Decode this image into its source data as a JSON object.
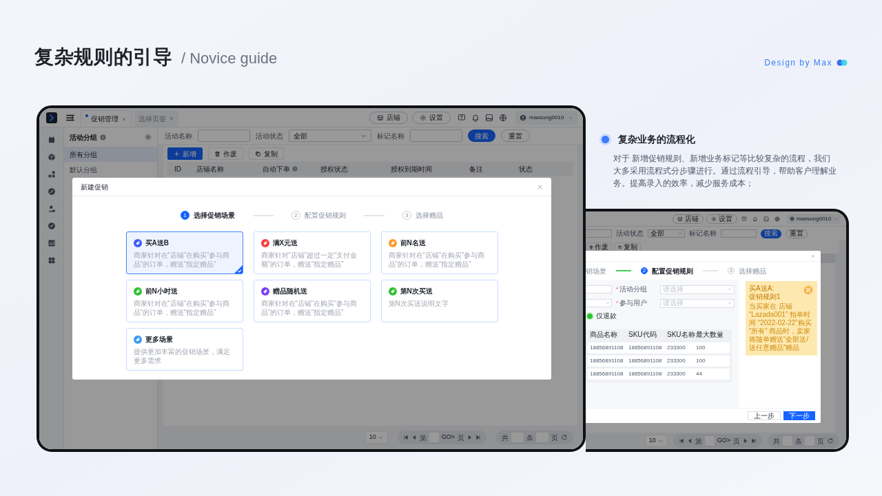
{
  "header": {
    "title": "复杂规则的引导",
    "subtitle": "/ Novice guide",
    "credit": "Design by Max"
  },
  "feature": {
    "title": "复杂业务的流程化",
    "text": "对于  新增促销规则、新增业务标记等比较复杂的流程，我们大多采用流程式分步骤进行。通过流程引导，帮助客户理解业务。提高录入的效率，减少服务成本；"
  },
  "main_screen": {
    "tabs": [
      {
        "label": "促销管理",
        "selected": true
      },
      {
        "label": "选择页签",
        "selected": false
      }
    ],
    "top_buttons": [
      "店铺",
      "设置"
    ],
    "user": "maxsong0010",
    "group_panel": {
      "title": "活动分组",
      "items": [
        {
          "label": "所有分组",
          "selected": true
        },
        {
          "label": "默认分组",
          "selected": false
        }
      ]
    },
    "filters": [
      {
        "label": "活动名称",
        "kind": "input"
      },
      {
        "label": "活动状态",
        "kind": "select",
        "value": "全部"
      },
      {
        "label": "标记名称",
        "kind": "input"
      }
    ],
    "filter_buttons": [
      {
        "label": "搜索",
        "primary": true
      },
      {
        "label": "重置",
        "primary": false
      }
    ],
    "toolbar": [
      {
        "label": "新增",
        "kind": "add"
      },
      {
        "label": "作废",
        "kind": "void"
      },
      {
        "label": "复制",
        "kind": "copy"
      }
    ],
    "table_columns": [
      "ID",
      "店铺名称",
      "自动下单",
      "授权状态",
      "授权到期时间",
      "备注",
      "状态"
    ],
    "modal": {
      "title": "新建促销",
      "steps": [
        {
          "number": "1",
          "label": "选择促销场景",
          "current": true,
          "done": false
        },
        {
          "number": "2",
          "label": "配置促销规则",
          "current": false,
          "done": false
        },
        {
          "number": "3",
          "label": "选择赠品",
          "current": false,
          "done": false
        }
      ],
      "cards": [
        {
          "title": "买A送B",
          "text": "商家针对在“店铺”在购买“参与商品”的订单，赠送“指定赠品”",
          "color": "#3d5afe",
          "selected": true
        },
        {
          "title": "满X元送",
          "text": "商家针对“店铺”超过一定“支付金额”的订单，赠送“指定赠品”",
          "color": "#f53f3f",
          "selected": false
        },
        {
          "title": "前N名送",
          "text": "商家针对在“店铺”在购买“参与商品”的订单，赠送“指定赠品”",
          "color": "#ff9a2e",
          "selected": false
        },
        {
          "title": "前N小时送",
          "text": "商家针对在“店铺”在购买“参与商品”的订单，赠送“指定赠品”",
          "color": "#2fc22f",
          "selected": false
        },
        {
          "title": "赠品随机送",
          "text": "商家针对在“店铺”在购买“参与商品”的订单，赠送“指定赠品”",
          "color": "#7b3ff2",
          "selected": false
        },
        {
          "title": "第N次买送",
          "text": "第N次买送说明文字",
          "color": "#2fc22f",
          "selected": false
        },
        {
          "title": "更多场景",
          "text": "提供更加丰富的促销场景，满足更多需求",
          "color": "#3b9cf6",
          "selected": false
        }
      ]
    },
    "pagination": {
      "page_size": "10",
      "first": "第",
      "go": "GO>",
      "page": "页",
      "total": "共",
      "items": "条",
      "pages": "页"
    }
  },
  "side_screen": {
    "top_buttons": [
      "店铺",
      "设置"
    ],
    "user": "maxsong0010",
    "filters": [
      {
        "label": "活动状态",
        "kind": "select",
        "value": "全部"
      },
      {
        "label": "标记名称",
        "kind": "input"
      }
    ],
    "filter_buttons": [
      {
        "label": "搜索",
        "primary": true
      },
      {
        "label": "重置",
        "primary": false
      }
    ],
    "toolbar": [
      {
        "label": "作废",
        "kind": "void"
      },
      {
        "label": "复制",
        "kind": "copy"
      }
    ],
    "steps": [
      {
        "label": "销场景",
        "current": false,
        "done": true
      },
      {
        "number": "2",
        "label": "配置促销规则",
        "current": true,
        "done": false
      },
      {
        "number": "3",
        "label": "选择赠品",
        "current": false,
        "done": false
      }
    ],
    "form": [
      {
        "marker": "*",
        "label": "活动分组",
        "placeholder": "请选择"
      },
      {
        "marker": "*",
        "label": "参与用户",
        "placeholder": "请选择"
      }
    ],
    "radio": {
      "label": "仅退款",
      "checked": true
    },
    "table": {
      "columns": [
        "商品名称",
        "SKU代码",
        "SKU名称",
        "最大数量"
      ],
      "rows": [
        [
          "18856891108",
          "18856891108",
          "233300",
          "100"
        ],
        [
          "18856891108",
          "18856891108",
          "233300",
          "100"
        ],
        [
          "18856891108",
          "18856891108",
          "233300",
          "44"
        ]
      ]
    },
    "tip": {
      "title": "买A送A:",
      "subtitle": "促销规则1",
      "text": "当买家在 店铺 “Lazada001” 拍单时间 “2022-02-22”购买 “所有” 商品时，卖家将随单赠送“全部送/送任意赠品”赠品"
    },
    "footer_buttons": [
      {
        "label": "上一步",
        "primary": false
      },
      {
        "label": "下一步",
        "primary": true
      }
    ],
    "pagination": {
      "page_size": "10",
      "first": "第",
      "go": "GO>",
      "page": "页",
      "total": "共",
      "items": "条",
      "pages": "页"
    }
  }
}
